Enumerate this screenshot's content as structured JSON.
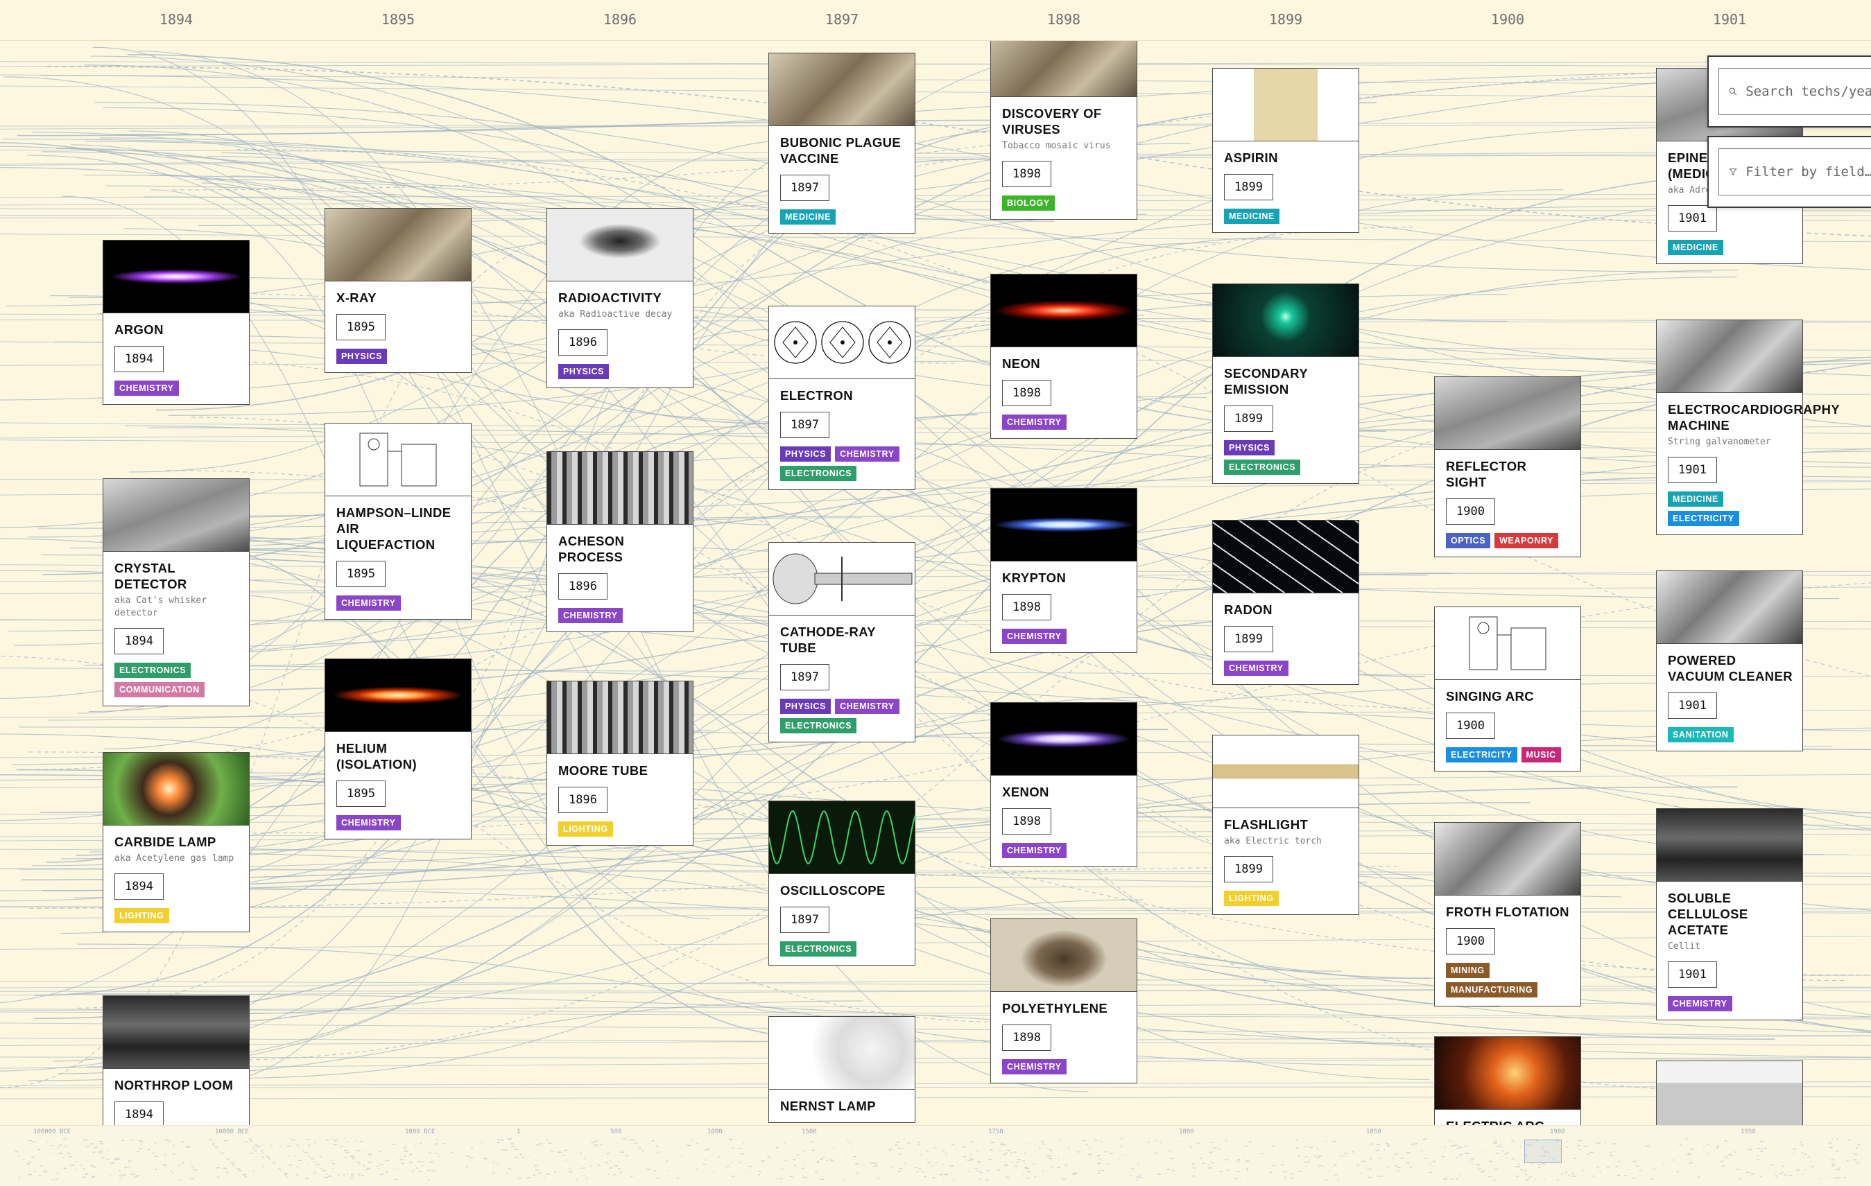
{
  "colors": {
    "background": "#fdf7e0",
    "link_line": "#9db3c6",
    "tags": {
      "CHEMISTRY": "#8b46c8",
      "PHYSICS": "#6a3bb8",
      "ELECTRONICS": "#2e9e6a",
      "COMMUNICATION": "#d27aa6",
      "LIGHTING": "#f1cf2e",
      "MEDICINE": "#16a3b3",
      "BIOLOGY": "#3db52a",
      "OPTICS": "#4a63c4",
      "WEAPONRY": "#d73a3a",
      "ELECTRICITY": "#1a8fe0",
      "MUSIC": "#c8287a",
      "SANITATION": "#1cb8b8",
      "MINING": "#8b5a2b",
      "MANUFACTURING": "#8b5a2b"
    }
  },
  "years": [
    "1894",
    "1895",
    "1896",
    "1897",
    "1898",
    "1899",
    "1900",
    "1901"
  ],
  "search": {
    "placeholder": "Search techs/years…",
    "icon": "search-icon"
  },
  "filter": {
    "placeholder": "Filter by field…",
    "icon": "filter-icon"
  },
  "minimap": {
    "labels": [
      "100000 BCE",
      "10000 BCE",
      "1000 BCE",
      "1",
      "500",
      "1000",
      "1500",
      "1750",
      "1800",
      "1850",
      "1900",
      "1950"
    ]
  },
  "cards": [
    {
      "id": "argon",
      "title": "Argon",
      "year": "1894",
      "tags": [
        "CHEMISTRY"
      ],
      "thumb": "glow-purple"
    },
    {
      "id": "crystal-detector",
      "title": "Crystal Detector",
      "aka": "aka Cat's whisker detector",
      "year": "1894",
      "tags": [
        "ELECTRONICS",
        "COMMUNICATION"
      ],
      "thumb": "photo-gray"
    },
    {
      "id": "carbide-lamp",
      "title": "Carbide Lamp",
      "aka": "aka Acetylene gas lamp",
      "year": "1894",
      "tags": [
        "LIGHTING"
      ],
      "thumb": "photo-green"
    },
    {
      "id": "northrop-loom",
      "title": "Northrop Loom",
      "year": "1894",
      "tags": [],
      "thumb": "photo-dark"
    },
    {
      "id": "x-ray",
      "title": "X-ray",
      "year": "1895",
      "tags": [
        "PHYSICS"
      ],
      "thumb": "photo-sepia"
    },
    {
      "id": "hampson-linde",
      "title": "Hampson–Linde air liquefaction",
      "year": "1895",
      "tags": [
        "CHEMISTRY"
      ],
      "thumb": "drawing"
    },
    {
      "id": "helium",
      "title": "Helium (isolation)",
      "year": "1895",
      "tags": [
        "CHEMISTRY"
      ],
      "thumb": "glow-orange"
    },
    {
      "id": "radioactivity",
      "title": "Radioactivity",
      "aka": "aka Radioactive decay",
      "year": "1896",
      "tags": [
        "PHYSICS"
      ],
      "thumb": "photo-smudge"
    },
    {
      "id": "acheson",
      "title": "Acheson Process",
      "year": "1896",
      "tags": [
        "CHEMISTRY"
      ],
      "thumb": "photo-factory"
    },
    {
      "id": "moore-tube",
      "title": "Moore Tube",
      "year": "1896",
      "tags": [
        "LIGHTING"
      ],
      "thumb": "photo-factory"
    },
    {
      "id": "bubonic",
      "title": "Bubonic Plague Vaccine",
      "year": "1897",
      "tags": [
        "MEDICINE"
      ],
      "thumb": "photo-sepia"
    },
    {
      "id": "electron",
      "title": "Electron",
      "year": "1897",
      "tags": [
        "PHYSICS",
        "CHEMISTRY",
        "ELECTRONICS"
      ],
      "thumb": "atoms"
    },
    {
      "id": "crt",
      "title": "Cathode-ray tube",
      "year": "1897",
      "tags": [
        "PHYSICS",
        "CHEMISTRY",
        "ELECTRONICS"
      ],
      "thumb": "tube"
    },
    {
      "id": "oscilloscope",
      "title": "Oscilloscope",
      "year": "1897",
      "tags": [
        "ELECTRONICS"
      ],
      "thumb": "wave"
    },
    {
      "id": "nernst",
      "title": "Nernst Lamp",
      "year": "",
      "tags": [],
      "thumb": "photo-bulb"
    },
    {
      "id": "viruses",
      "title": "Discovery of Viruses",
      "aka": "Tobacco mosaic virus",
      "year": "1898",
      "tags": [
        "BIOLOGY"
      ],
      "thumb": "photo-sepia"
    },
    {
      "id": "neon",
      "title": "Neon",
      "year": "1898",
      "tags": [
        "CHEMISTRY"
      ],
      "thumb": "glow-red"
    },
    {
      "id": "krypton",
      "title": "Krypton",
      "year": "1898",
      "tags": [
        "CHEMISTRY"
      ],
      "thumb": "glow-white"
    },
    {
      "id": "xenon",
      "title": "Xenon",
      "year": "1898",
      "tags": [
        "CHEMISTRY"
      ],
      "thumb": "glow-violet"
    },
    {
      "id": "polyethylene",
      "title": "Polyethylene",
      "year": "1898",
      "tags": [
        "CHEMISTRY"
      ],
      "thumb": "photo-brown"
    },
    {
      "id": "aspirin",
      "title": "Aspirin",
      "year": "1899",
      "tags": [
        "MEDICINE"
      ],
      "thumb": "photo-bottle"
    },
    {
      "id": "secondary-emission",
      "title": "Secondary emission",
      "year": "1899",
      "tags": [
        "PHYSICS",
        "ELECTRONICS"
      ],
      "thumb": "glow-green"
    },
    {
      "id": "radon",
      "title": "Radon",
      "year": "1899",
      "tags": [
        "CHEMISTRY"
      ],
      "thumb": "crystals"
    },
    {
      "id": "flashlight",
      "title": "Flashlight",
      "aka": "aka Electric torch",
      "year": "1899",
      "tags": [
        "LIGHTING"
      ],
      "thumb": "photo-torch"
    },
    {
      "id": "reflector-sight",
      "title": "Reflector sight",
      "year": "1900",
      "tags": [
        "OPTICS",
        "WEAPONRY"
      ],
      "thumb": "photo-gray"
    },
    {
      "id": "singing-arc",
      "title": "Singing arc",
      "year": "1900",
      "tags": [
        "ELECTRICITY",
        "MUSIC"
      ],
      "thumb": "drawing"
    },
    {
      "id": "froth-flotation",
      "title": "Froth flotation",
      "year": "1900",
      "tags": [
        "MINING",
        "MANUFACTURING"
      ],
      "thumb": "photo-machine"
    },
    {
      "id": "electric-arc",
      "title": "Electric arc",
      "year": "",
      "tags": [],
      "thumb": "photo-fire"
    },
    {
      "id": "epinephrine",
      "title": "Epinephrine (Medicine)",
      "aka": "aka Adrenaline",
      "year": "1901",
      "tags": [
        "MEDICINE"
      ],
      "thumb": "photo-gray"
    },
    {
      "id": "ecg",
      "title": "Electrocardiography machine",
      "aka": "String galvanometer",
      "year": "1901",
      "tags": [
        "MEDICINE",
        "ELECTRICITY"
      ],
      "thumb": "photo-machine"
    },
    {
      "id": "vacuum",
      "title": "Powered vacuum cleaner",
      "year": "1901",
      "tags": [
        "SANITATION"
      ],
      "thumb": "photo-machine"
    },
    {
      "id": "cellulose",
      "title": "Soluble cellulose acetate",
      "aka": "Cellit",
      "year": "1901",
      "tags": [
        "CHEMISTRY"
      ],
      "thumb": "photo-dark"
    },
    {
      "id": "chromatography",
      "title": "",
      "year": "",
      "tags": [],
      "thumb": "photo-strip"
    }
  ]
}
